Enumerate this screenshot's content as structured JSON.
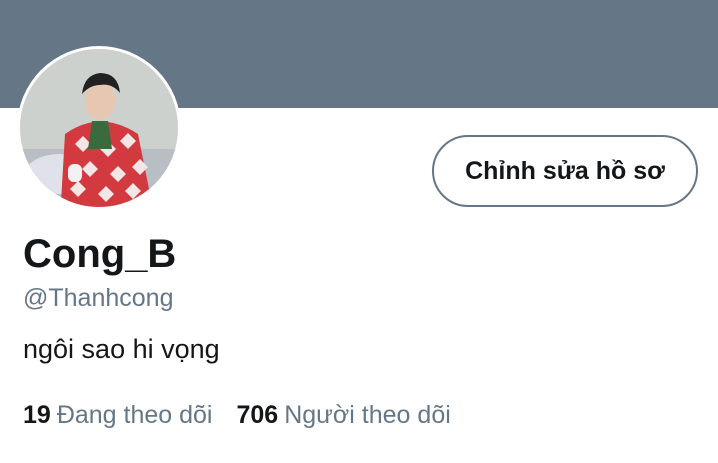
{
  "profile": {
    "display_name": "Cong_B",
    "handle": "@Thanhcong",
    "bio": "ngôi sao hi vọng",
    "avatar": "avatar-photo"
  },
  "actions": {
    "edit_profile_label": "Chỉnh sửa hồ sơ"
  },
  "stats": {
    "following_count": "19",
    "following_label": "Đang theo dõi",
    "followers_count": "706",
    "followers_label": "Người theo dõi"
  },
  "colors": {
    "banner": "#657786",
    "text_primary": "#14171a",
    "text_secondary": "#657786",
    "background": "#ffffff"
  }
}
